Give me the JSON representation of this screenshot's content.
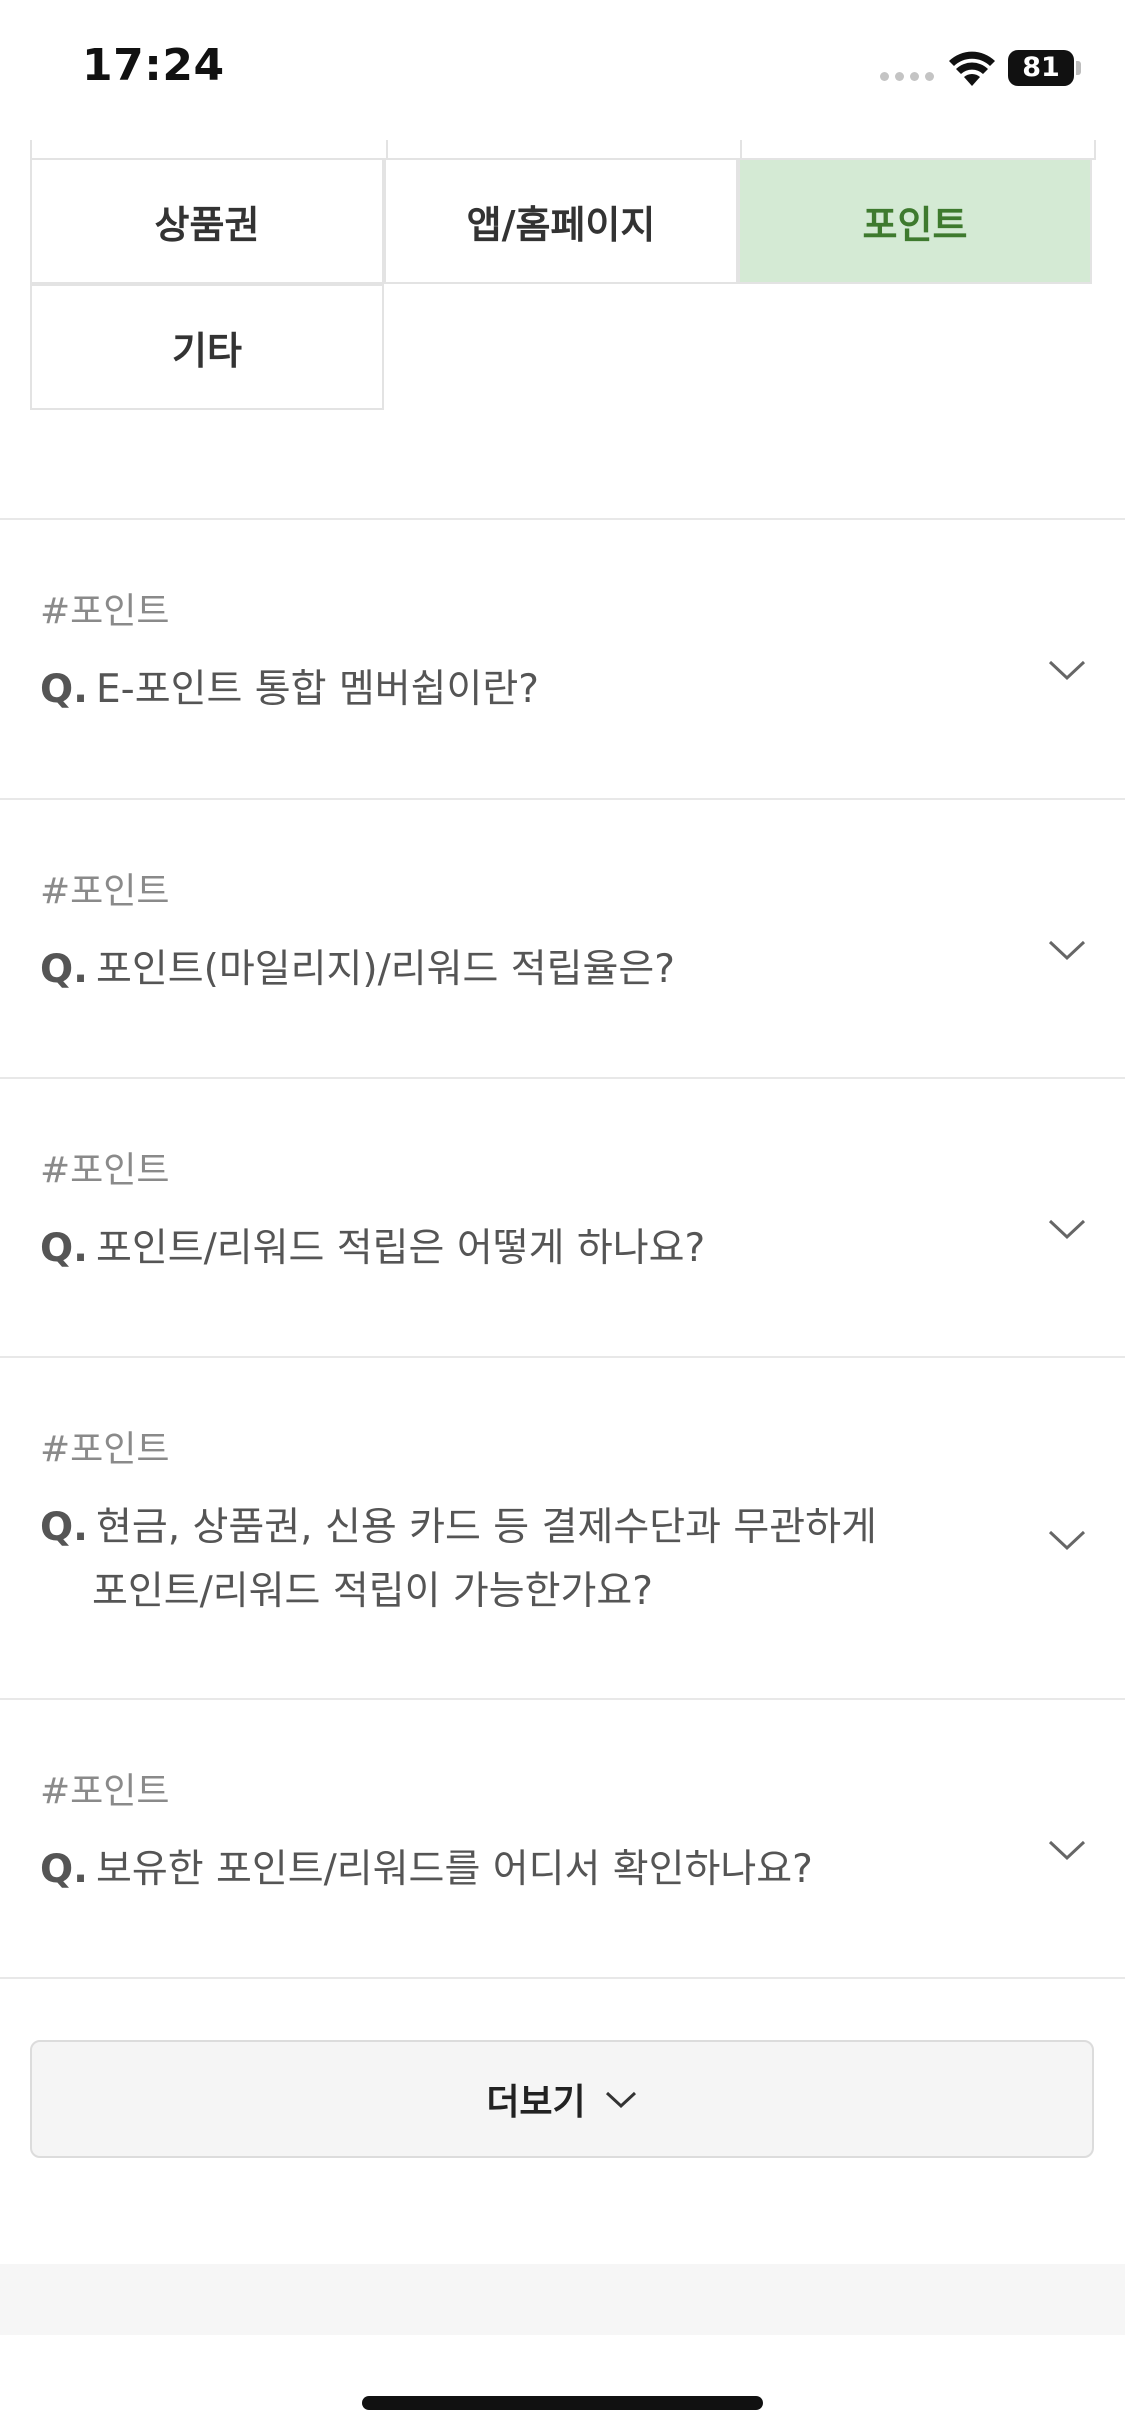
{
  "status_bar": {
    "time": "17:24",
    "battery": "81"
  },
  "categories": [
    {
      "label": "상품권",
      "active": false
    },
    {
      "label": "앱/홈페이지",
      "active": false
    },
    {
      "label": "포인트",
      "active": true
    },
    {
      "label": "기타",
      "active": false
    }
  ],
  "faq": {
    "q_prefix": "Q.",
    "items": [
      {
        "tag": "#포인트",
        "question": "E-포인트 통합 멤버쉽이란?"
      },
      {
        "tag": "#포인트",
        "question": "포인트(마일리지)/리워드 적립율은?"
      },
      {
        "tag": "#포인트",
        "question": "포인트/리워드 적립은 어떻게 하나요?"
      },
      {
        "tag": "#포인트",
        "question_line1": "현금, 상품권, 신용 카드 등 결제수단과 무관하게",
        "question_line2": "포인트/리워드 적립이 가능한가요?"
      },
      {
        "tag": "#포인트",
        "question": "보유한 포인트/리워드를 어디서 확인하나요?"
      }
    ]
  },
  "more_button": {
    "label": "더보기"
  },
  "icons": {
    "signal": "cellular-signal-icon",
    "wifi": "wifi-icon",
    "battery": "battery-icon",
    "chevron": "chevron-down-icon"
  },
  "colors": {
    "active_bg": "#d4ead4",
    "active_text": "#3e7a2e",
    "tag_text": "#8a8a8a",
    "divider": "#e8e8e8"
  }
}
